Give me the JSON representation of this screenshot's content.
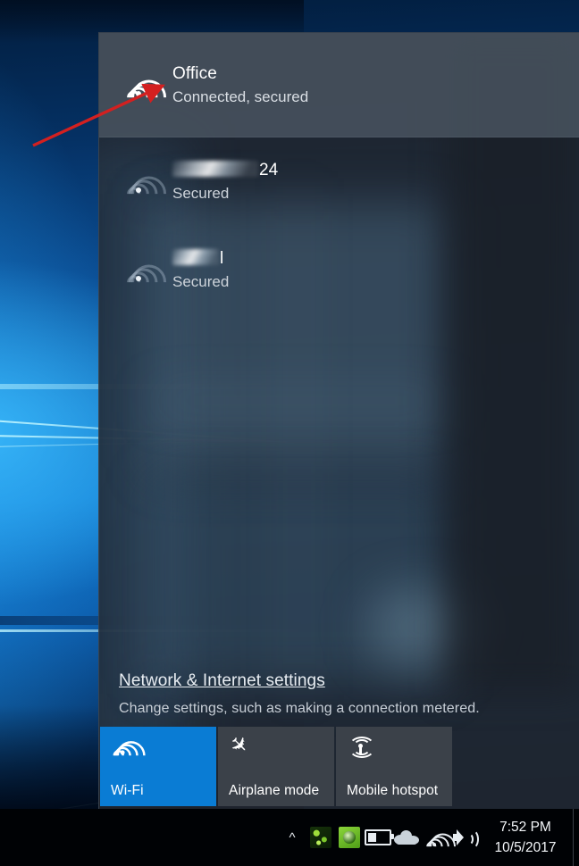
{
  "desktop": {
    "name": "windows-desktop-wallpaper"
  },
  "flyout": {
    "networks": [
      {
        "name": "Office",
        "name_redacted": false,
        "status": "Connected, secured",
        "selected": true,
        "signal": "full",
        "icon": "wifi-icon"
      },
      {
        "name": "24",
        "name_redacted": true,
        "redacted_width": 96,
        "status": "Secured",
        "selected": false,
        "signal": "weak",
        "icon": "wifi-icon"
      },
      {
        "name": "l",
        "name_redacted": true,
        "redacted_width": 52,
        "status": "Secured",
        "selected": false,
        "signal": "weak",
        "icon": "wifi-icon"
      }
    ],
    "settings_link": "Network & Internet settings",
    "settings_desc": "Change settings, such as making a connection metered.",
    "tiles": [
      {
        "label": "Wi-Fi",
        "icon": "wifi-icon",
        "active": true
      },
      {
        "label": "Airplane mode",
        "icon": "airplane-icon",
        "active": false
      },
      {
        "label": "Mobile hotspot",
        "icon": "hotspot-icon",
        "active": false
      }
    ]
  },
  "taskbar": {
    "show_hidden_icons": "^",
    "tray_icons": [
      "chevron-up-icon",
      "app-green-icon-1",
      "app-green-icon-2",
      "battery-icon",
      "onedrive-cloud-icon",
      "wifi-icon",
      "volume-speaker-icon"
    ],
    "clock": {
      "time": "7:52 PM",
      "date": "10/5/2017"
    }
  },
  "annotation": {
    "type": "red-arrow",
    "color": "#d32020",
    "points_to": "wifi-icon of Office network"
  }
}
